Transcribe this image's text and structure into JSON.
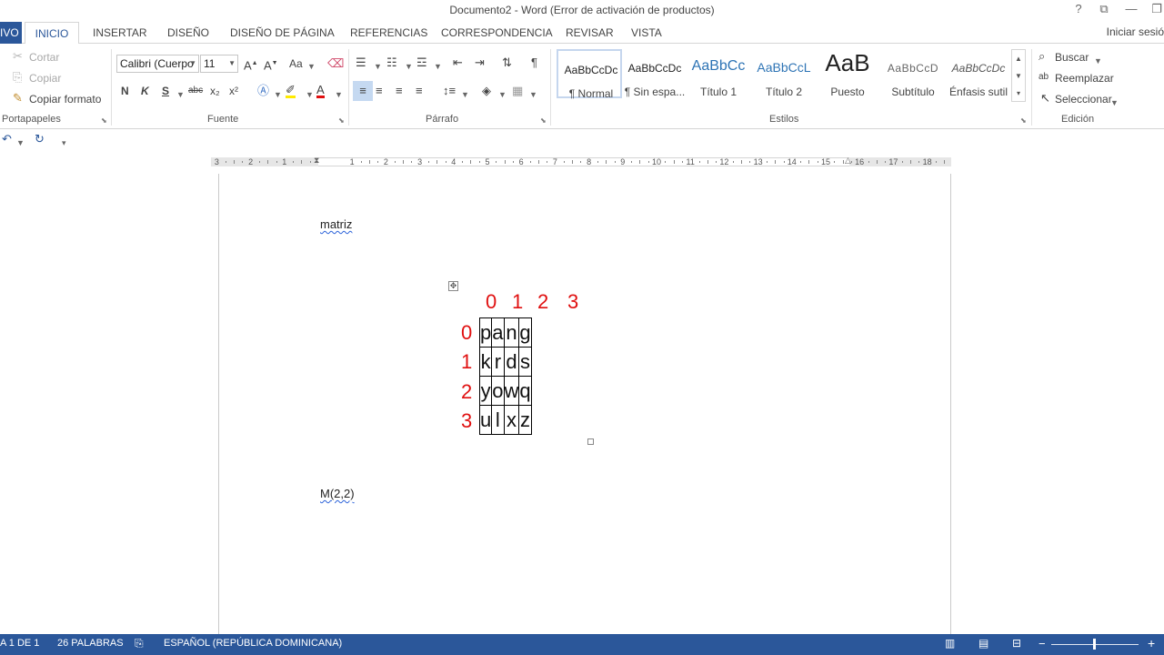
{
  "window": {
    "title": "Documento2 - Word (Error de activación de productos)",
    "controls": [
      "?",
      "⧉",
      "—",
      "❐"
    ]
  },
  "tabs": {
    "file": "IVO",
    "items": [
      "INICIO",
      "INSERTAR",
      "DISEÑO",
      "DISEÑO DE PÁGINA",
      "REFERENCIAS",
      "CORRESPONDENCIA",
      "REVISAR",
      "VISTA"
    ],
    "signin": "Iniciar sesió"
  },
  "ribbon": {
    "clipboard": {
      "cut": "Cortar",
      "copy": "Copiar",
      "format_painter": "Copiar formato",
      "label": "Portapapeles"
    },
    "font": {
      "family": "Calibri (Cuerpo",
      "size": "11",
      "bold": "N",
      "italic": "K",
      "underline": "S",
      "strike": "abc",
      "subscript": "x₂",
      "superscript": "x²",
      "case": "Aa",
      "label": "Fuente"
    },
    "paragraph": {
      "label": "Párrafo"
    },
    "styles": {
      "label": "Estilos",
      "items": [
        {
          "preview": "AaBbCcDc",
          "name": "¶ Normal"
        },
        {
          "preview": "AaBbCcDc",
          "name": "¶ Sin espa..."
        },
        {
          "preview": "AaBbCc",
          "name": "Título 1"
        },
        {
          "preview": "AaBbCcL",
          "name": "Título 2"
        },
        {
          "preview": "AaB",
          "name": "Puesto"
        },
        {
          "preview": "AaBbCcD",
          "name": "Subtítulo"
        },
        {
          "preview": "AaBbCcDc",
          "name": "Énfasis sutil"
        }
      ]
    },
    "editing": {
      "find": "Buscar",
      "replace": "Reemplazar",
      "select": "Seleccionar",
      "label": "Edición"
    }
  },
  "ruler": {
    "numbers": [
      "3",
      "2",
      "1",
      "1",
      "2",
      "3",
      "4",
      "5",
      "6",
      "7",
      "8",
      "9",
      "10",
      "11",
      "12",
      "13",
      "14",
      "15",
      "16",
      "17",
      "18"
    ]
  },
  "document": {
    "heading": "matriz",
    "col_indices": [
      "0",
      "1",
      "2",
      "3"
    ],
    "row_indices": [
      "0",
      "1",
      "2",
      "3"
    ],
    "grid": [
      [
        "p",
        "a",
        "n",
        "g"
      ],
      [
        "k",
        "r",
        "d",
        "s"
      ],
      [
        "y",
        "o",
        "w",
        "q"
      ],
      [
        "u",
        "l",
        "x",
        "z"
      ]
    ],
    "expression": "M(2,2)",
    "index_color": "#e01010"
  },
  "status": {
    "page": "A 1 DE 1",
    "words": "26 PALABRAS",
    "language": "ESPAÑOL (REPÚBLICA DOMINICANA)",
    "zoom_plus": "+",
    "zoom_minus": "−"
  },
  "colors": {
    "accent": "#2b579a"
  }
}
